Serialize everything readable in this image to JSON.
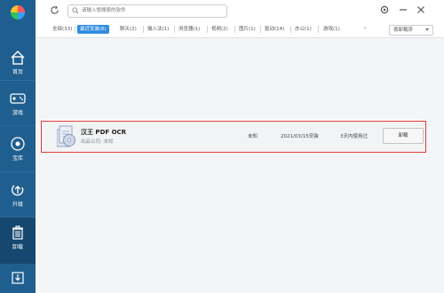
{
  "sidebar": {
    "items": [
      {
        "label": "首页",
        "icon": "home-icon"
      },
      {
        "label": "游戏",
        "icon": "gamepad-icon"
      },
      {
        "label": "宝库",
        "icon": "treasure-icon"
      },
      {
        "label": "升级",
        "icon": "upgrade-icon"
      },
      {
        "label": "卸载",
        "icon": "trash-icon"
      }
    ],
    "active": "卸载"
  },
  "search": {
    "placeholder": "请输入想搜索的软件"
  },
  "tabs": [
    {
      "label": "全部(33)"
    },
    {
      "label": "最近安装(6)",
      "active": true
    },
    {
      "label": "聊天(2)"
    },
    {
      "label": "输入法(1)"
    },
    {
      "label": "浏览器(1)"
    },
    {
      "label": "视频(2)"
    },
    {
      "label": "图片(1)"
    },
    {
      "label": "驱动(14)"
    },
    {
      "label": "办公(1)"
    },
    {
      "label": "游戏(1)"
    }
  ],
  "tabs_more": "›",
  "sort": {
    "label": "按卸载序"
  },
  "app": {
    "name": "汉王 PDF OCR",
    "publisher": "出品公司: 未知",
    "size": "未知",
    "install_date": "2021/03/15安装",
    "usage": "3天内使用过",
    "action": "卸载"
  },
  "colors": {
    "sidebar": "#1f5f8f",
    "accent": "#2f8be0",
    "highlight": "#e23a3a"
  }
}
